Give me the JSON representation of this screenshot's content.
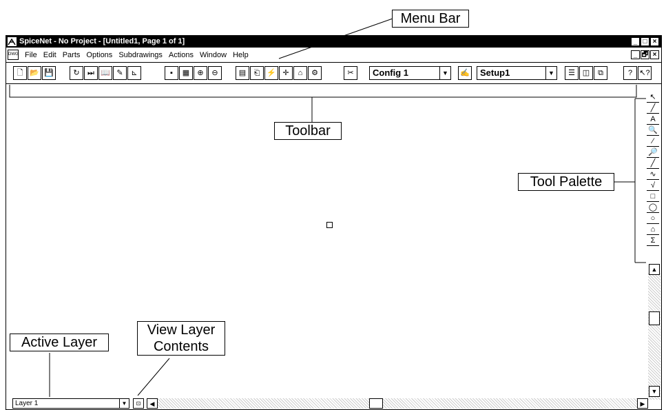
{
  "window": {
    "title": "SpiceNet - No Project - [Untitled1, Page 1 of 1]",
    "title_buttons": [
      "_",
      "□",
      "×"
    ],
    "doc_buttons": [
      "_",
      "🗗",
      "×"
    ]
  },
  "menu": {
    "doc_icon": "DWG",
    "items": [
      "File",
      "Edit",
      "Parts",
      "Options",
      "Subdrawings",
      "Actions",
      "Window",
      "Help"
    ]
  },
  "toolbar": {
    "config_value": "Config 1",
    "setup_value": "Setup1",
    "buttons": [
      {
        "name": "new-icon",
        "glyph": "🗋"
      },
      {
        "name": "open-icon",
        "glyph": "📂"
      },
      {
        "name": "save-icon",
        "glyph": "💾"
      },
      {
        "name": "refresh-icon",
        "glyph": "↻"
      },
      {
        "name": "step-icon",
        "glyph": "⏭"
      },
      {
        "name": "book-icon",
        "glyph": "📖"
      },
      {
        "name": "probe-icon",
        "glyph": "✎"
      },
      {
        "name": "node-icon",
        "glyph": "⊾"
      },
      {
        "name": "block-icon",
        "glyph": "▪"
      },
      {
        "name": "grid-icon",
        "glyph": "▦"
      },
      {
        "name": "zoom-in-icon",
        "glyph": "⊕"
      },
      {
        "name": "zoom-out-icon",
        "glyph": "⊖"
      },
      {
        "name": "page-icon",
        "glyph": "▤"
      },
      {
        "name": "netlist-icon",
        "glyph": "⎗"
      },
      {
        "name": "run-icon",
        "glyph": "⚡"
      },
      {
        "name": "cross-icon",
        "glyph": "✛"
      },
      {
        "name": "probe2-icon",
        "glyph": "⌂"
      },
      {
        "name": "sim-icon",
        "glyph": "⚙"
      },
      {
        "name": "config-icon",
        "glyph": "✂"
      },
      {
        "name": "setup-icon",
        "glyph": "✍"
      },
      {
        "name": "tile-horizontal-icon",
        "glyph": "☰"
      },
      {
        "name": "tile-vertical-icon",
        "glyph": "◫"
      },
      {
        "name": "cascade-icon",
        "glyph": "⧉"
      },
      {
        "name": "help-icon",
        "glyph": "?"
      },
      {
        "name": "context-help-icon",
        "glyph": "↖?"
      }
    ]
  },
  "palette": [
    "↖",
    "╱",
    "A",
    "🔍",
    "⁄",
    "🔎",
    "╱",
    "∿",
    "√",
    "□",
    "◯",
    "○",
    "⌂",
    "Σ"
  ],
  "status": {
    "active_layer": "Layer 1"
  },
  "annotations": {
    "menu_bar": "Menu Bar",
    "toolbar": "Toolbar",
    "tool_palette": "Tool Palette",
    "active_layer": "Active Layer",
    "view_layer_contents": "View Layer Contents"
  },
  "icons": {
    "app_logo": "spicenet-logo-icon",
    "center_mark": "origin-marker-icon"
  }
}
